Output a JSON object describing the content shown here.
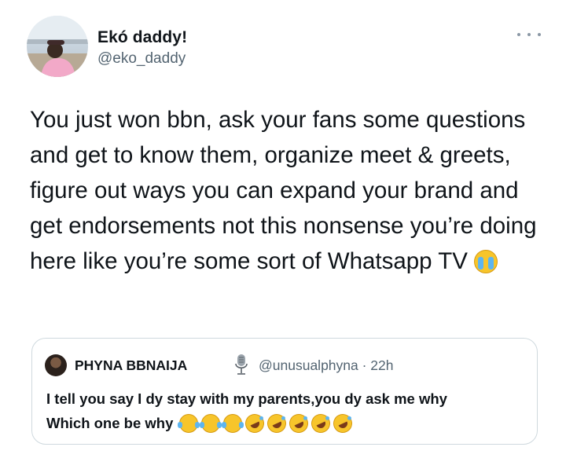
{
  "tweet": {
    "author": {
      "display_name": "Ekó daddy!",
      "handle": "@eko_daddy",
      "avatar_icon": "user-avatar"
    },
    "more_icon": "more-horizontal-icon",
    "text": "You just won bbn, ask your fans some questions and get to know them, organize meet & greets, figure out ways you can expand your brand and get endorsements not this nonsense you’re doing here like you’re some sort of Whatsapp TV",
    "text_emoji": "loudly-crying-face-emoji"
  },
  "quoted_tweet": {
    "author": {
      "display_name": "PHYNA BBNAIJA",
      "badge_icon": "microphone-icon",
      "handle_time": "@unusualphyna · 22h",
      "avatar_icon": "user-avatar"
    },
    "line1": "I tell you say I dy stay with my parents,you dy ask me why",
    "line2": "Which one be why",
    "emojis": [
      "face-with-tears-of-joy",
      "face-with-tears-of-joy",
      "face-with-tears-of-joy",
      "rolling-on-the-floor-laughing",
      "rolling-on-the-floor-laughing",
      "rolling-on-the-floor-laughing",
      "rolling-on-the-floor-laughing",
      "rolling-on-the-floor-laughing"
    ]
  },
  "colors": {
    "text": "#0f1419",
    "secondary": "#536471",
    "border": "#cfd9de"
  }
}
